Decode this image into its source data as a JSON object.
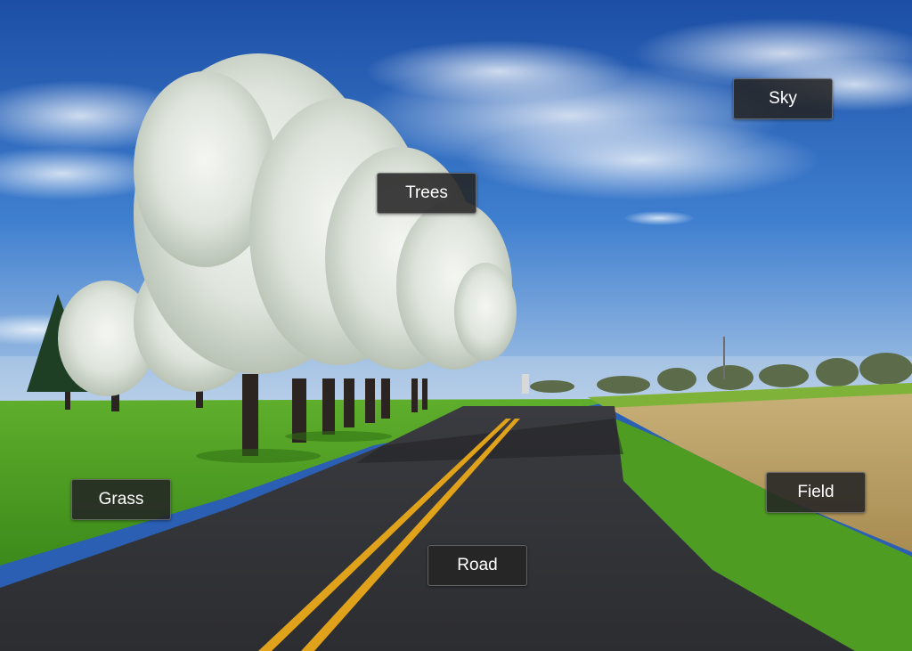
{
  "scene": {
    "labels": {
      "sky": "Sky",
      "trees": "Trees",
      "grass": "Grass",
      "field": "Field",
      "road": "Road"
    }
  }
}
